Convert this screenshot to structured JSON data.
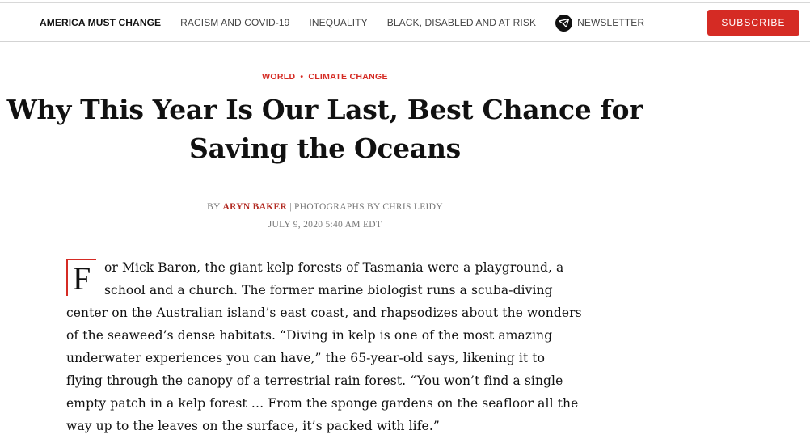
{
  "nav": {
    "items": [
      {
        "label": "AMERICA MUST CHANGE"
      },
      {
        "label": "RACISM AND COVID-19"
      },
      {
        "label": "INEQUALITY"
      },
      {
        "label": "BLACK, DISABLED AND AT RISK"
      }
    ],
    "newsletter_label": "NEWSLETTER",
    "newsletter_icon": "newsletter-plane-icon",
    "subscribe_label": "SUBSCRIBE"
  },
  "article": {
    "kicker": [
      "WORLD",
      "CLIMATE CHANGE"
    ],
    "kicker_separator": "•",
    "headline_line1": "Why This Year Is Our Last, Best Chance for",
    "headline_line2": "Saving the Oceans",
    "by": "BY",
    "author": "ARYN BAKER",
    "photo_credit": "| PHOTOGRAPHS BY CHRIS LEIDY",
    "date": "JULY 9, 2020 5:40 AM EDT",
    "dropcap": "F",
    "body_lines": [
      "or Mick Baron, the giant kelp forests of Tasmania were a playground, a",
      "school and a church. The former marine biologist runs a scuba-diving",
      "center on the Australian island’s east coast, and rhapsodizes about the wonders",
      "of the seaweed’s dense habitats. “Diving in kelp is one of the most amazing",
      "underwater experiences you can have,” the 65-year-old says, likening it to",
      "flying through the canopy of a terrestrial rain forest. “You won’t find a single",
      "empty patch in a kelp forest … From the sponge gardens on the seafloor all the",
      "way up to the leaves on the surface, it’s packed with life.”"
    ]
  },
  "colors": {
    "accent": "#d52b24",
    "author": "#b22a22"
  }
}
